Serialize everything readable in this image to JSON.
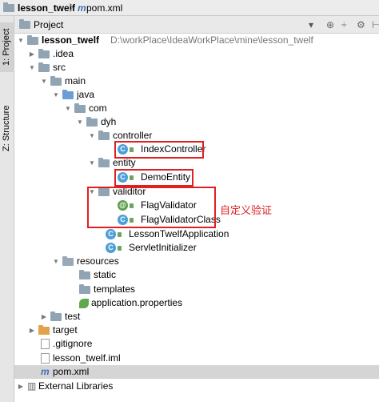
{
  "breadcrumb": {
    "project": "lesson_twelf",
    "file_icon": "m",
    "file": "pom.xml"
  },
  "side_tabs": {
    "project": "1: Project",
    "structure": "Z: Structure"
  },
  "panel": {
    "title": "Project",
    "dropdown_icon": "▾",
    "icons": [
      "⊕",
      "÷",
      "⚙",
      "⊢"
    ]
  },
  "tree": {
    "root_name": "lesson_twelf",
    "root_path": "D:\\workPlace\\IdeaWorkPlace\\mine\\lesson_twelf",
    "idea": ".idea",
    "src": "src",
    "main": "main",
    "java": "java",
    "com": "com",
    "dyh": "dyh",
    "controller": "controller",
    "index_controller": "IndexController",
    "entity": "entity",
    "demo_entity": "DemoEntity",
    "validitor": "validitor",
    "flag_validator": "FlagValidator",
    "flag_validator_class": "FlagValidatorClass",
    "app": "LessonTwelfApplication",
    "servlet": "ServletInitializer",
    "resources": "resources",
    "static": "static",
    "templates": "templates",
    "app_props": "application.properties",
    "test": "test",
    "target": "target",
    "gitignore": ".gitignore",
    "iml": "lesson_twelf.iml",
    "pom": "pom.xml",
    "ext_libs": "External Libraries"
  },
  "annotation": "自定义验证",
  "colors": {
    "highlight": "#e02020",
    "folder": "#90a4b3",
    "source_folder": "#6b9ed7",
    "class": "#4d9fd7"
  }
}
